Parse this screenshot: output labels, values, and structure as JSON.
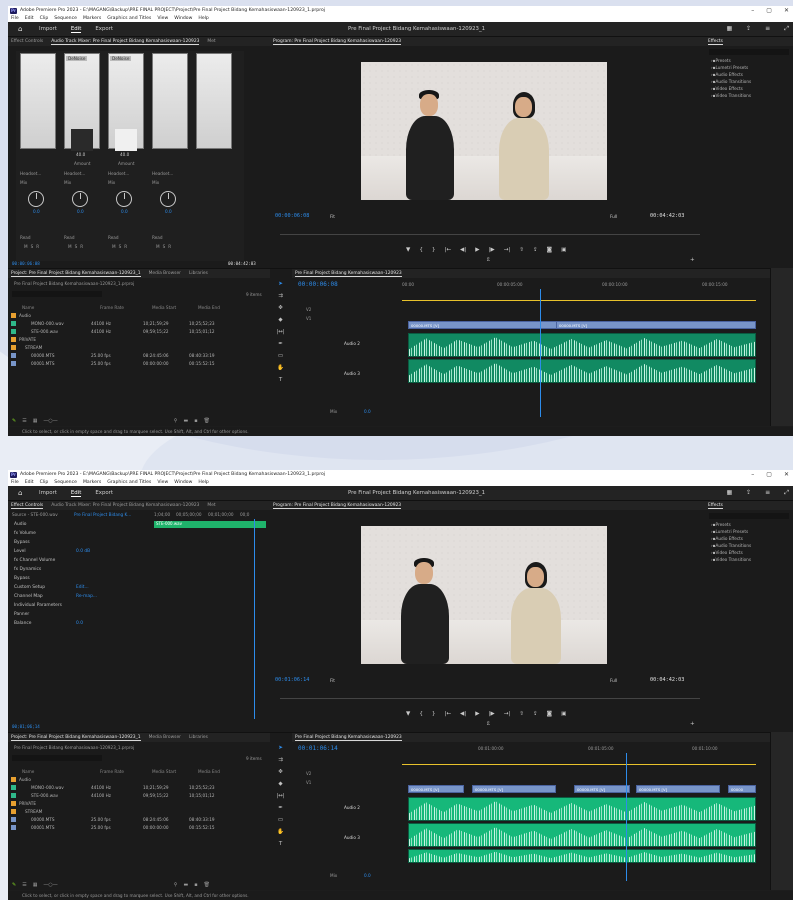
{
  "app": {
    "window_title": "Adobe Premiere Pro 2023 - E:\\MAGANG\\Backup\\PRE FINAL PROJECT\\Project\\Pre Final Project Bidang Kemahasiswaan-120923_1.prproj",
    "window_title_2": "Adobe Premiere Pro 2023 - E:\\MAGANG\\Backup\\PRE FINAL PROJECT\\Project\\Pre Final Project Bidang Kemahasiswaan-120923_1.prproj",
    "menu": [
      "File",
      "Edit",
      "Clip",
      "Sequence",
      "Markers",
      "Graphics and Titles",
      "View",
      "Window",
      "Help"
    ],
    "workspace_tabs": [
      "Import",
      "Edit",
      "Export"
    ],
    "active_workspace": "Edit",
    "project_title": "Pre Final Project Bidang Kemahasiswaan-120923_1",
    "controls": [
      "–",
      "▢",
      "✕"
    ]
  },
  "shot1": {
    "left_panel_tabs": [
      "Effect Controls",
      "Audio Track Mixer: Pre Final Project Bidang Kemahasiswaan-120923",
      "Met"
    ],
    "mixer": {
      "effect_slots": [
        "DeNoise",
        "DeNoise"
      ],
      "knob_values": [
        "40.0",
        "40.0"
      ],
      "knob_labels": [
        "Amount",
        "Amount"
      ],
      "output": [
        "Headset...",
        "Headset...",
        "Headset...",
        "Headset..."
      ],
      "mode": [
        "Mix",
        "Mix",
        "Mix",
        "Mix"
      ],
      "pan_values": [
        "0.0",
        "0.0",
        "0.0",
        "0.0"
      ],
      "auto_mode": [
        "Read",
        "Read",
        "Read",
        "Read"
      ],
      "msr": [
        "M",
        "S",
        "R"
      ],
      "time_left": "00:00:06:08",
      "time_right": "00:04:42:03"
    },
    "program": {
      "title": "Program: Pre Final Project Bidang Kemahasiswaan-120923",
      "timecode": "00:00:06:08",
      "fit": "Fit",
      "quality": "Full",
      "duration": "00:04:42:03"
    },
    "effects": {
      "title": "Effects",
      "items": [
        "Presets",
        "Lumetri Presets",
        "Audio Effects",
        "Audio Transitions",
        "Video Effects",
        "Video Transitions"
      ]
    },
    "project": {
      "tabs": [
        "Project: Pre Final Project Bidang Kemahasiswaan-120923_1",
        "Media Browser",
        "Libraries"
      ],
      "file": "Pre Final Project Bidang Kemahasiswaan-120923_1.prproj",
      "count": "9 items",
      "columns": [
        "Name",
        "Frame Rate",
        "Media Start",
        "Media End"
      ],
      "rows": [
        {
          "name": "Audio",
          "fps": "",
          "start": "",
          "end": "",
          "color": "#e8a030",
          "indent": 0
        },
        {
          "name": "MONO-000.wav",
          "fps": "44100 Hz",
          "start": "10;21;59;29",
          "end": "10;25;52;23",
          "color": "#2fb88a",
          "indent": 2
        },
        {
          "name": "STE-000.wav",
          "fps": "44100 Hz",
          "start": "09;59;15;22",
          "end": "10;15;01;12",
          "color": "#2fb88a",
          "indent": 2
        },
        {
          "name": "PRIVATE",
          "fps": "",
          "start": "",
          "end": "",
          "color": "#e8a030",
          "indent": 0
        },
        {
          "name": "STREAM",
          "fps": "",
          "start": "",
          "end": "",
          "color": "#e8a030",
          "indent": 1
        },
        {
          "name": "00000.MTS",
          "fps": "25.00 fps",
          "start": "08:24:45:06",
          "end": "08:40:33:19",
          "color": "#7895c9",
          "indent": 2
        },
        {
          "name": "00001.MTS",
          "fps": "25.00 fps",
          "start": "00:00:00:00",
          "end": "00:15:52:15",
          "color": "#7895c9",
          "indent": 2
        }
      ]
    },
    "timeline": {
      "tab": "Pre Final Project Bidang Kemahasiswaan-120923",
      "timecode": "00:00:06:08",
      "ruler": [
        "00:00",
        "00:00:05:00",
        "00:00:10:00",
        "00:00:15:00"
      ],
      "tracks_v": [
        "V2",
        "V1"
      ],
      "tracks_a": [
        "Audio 2",
        "Audio 3"
      ],
      "master": "Mix",
      "master_val": "0.0",
      "clips": [
        "00000.MTS [V]",
        "00000.MTS [V]"
      ]
    },
    "status": "Click to select, or click in empty space and drag to marquee select. Use Shift, Alt, and Ctrl for other options."
  },
  "shot2": {
    "left_panel_tabs": [
      "Effect Controls",
      "Audio Track Mixer: Pre Final Project Bidang Kemahasiswaan-120923",
      "Met"
    ],
    "source": "Source - STE-000.wav",
    "source_seq": "Pre Final Project Bidang K...",
    "ec_ruler": [
      "1;04;00",
      "00;05;00;00",
      "00;01;00;00",
      "00;0"
    ],
    "clip_label": "STE-000.wav",
    "fx_rows": [
      {
        "label": "Audio",
        "val": ""
      },
      {
        "label": "fx Volume",
        "val": ""
      },
      {
        "label": "Bypass",
        "val": ""
      },
      {
        "label": "Level",
        "val": "0.0 dB"
      },
      {
        "label": "fx Channel Volume",
        "val": ""
      },
      {
        "label": "fx Dynamics",
        "val": ""
      },
      {
        "label": "Bypass",
        "val": ""
      },
      {
        "label": "Custom Setup",
        "val": "Edit..."
      },
      {
        "label": "Channel Map",
        "val": "Re-map..."
      },
      {
        "label": "Individual Parameters",
        "val": ""
      },
      {
        "label": "Panner",
        "val": ""
      },
      {
        "label": "Balance",
        "val": "0.0"
      }
    ],
    "ec_time": "00;01;06;14",
    "program": {
      "title": "Program: Pre Final Project Bidang Kemahasiswaan-120923",
      "timecode": "00:01:06:14",
      "fit": "Fit",
      "quality": "Full",
      "duration": "00:04:42:03"
    },
    "timeline": {
      "timecode": "00:01:06:14",
      "ruler": [
        "00:01:00:00",
        "00:01:05:00",
        "00:01:10:00"
      ],
      "clips": [
        "00000.MTS [V]",
        "00000.MTS [V]",
        "00000.MTS [V]",
        "00000.MTS [V]",
        "00000"
      ]
    }
  }
}
